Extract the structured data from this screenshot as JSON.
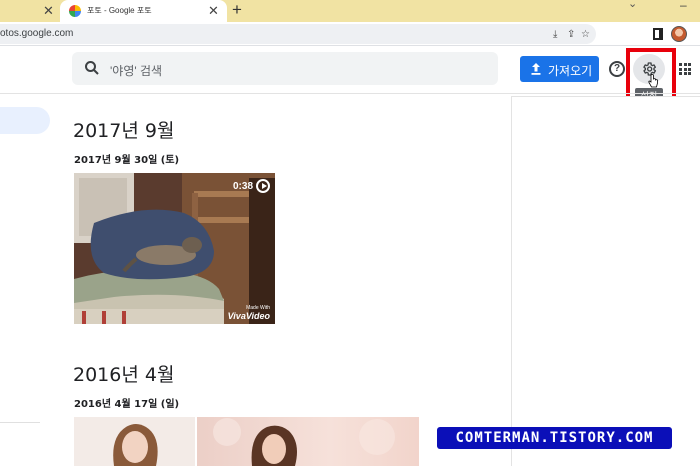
{
  "browser": {
    "tab_title": "포토 - Google 포토",
    "tab_close": "✕",
    "prev_tab_close": "✕",
    "new_tab": "+",
    "url": "otos.google.com"
  },
  "header": {
    "search_placeholder": "'야영' 검색",
    "import_label": "가져오기",
    "help_label": "?",
    "settings_tooltip": "설정"
  },
  "sections": [
    {
      "title": "2017년 9월",
      "date": "2017년 9월 30일 (토)",
      "video_duration": "0:38",
      "watermark_top": "Made With",
      "watermark_bottom": "VivaVideo"
    },
    {
      "title": "2016년 4월",
      "date": "2016년 4월 17일 (일)"
    }
  ],
  "banner": {
    "text": "COMTERMAN.TISTORY.COM"
  },
  "colors": {
    "accent": "#1a73e8",
    "highlight_box": "#e8000b",
    "tab_strip": "#f1e3a3",
    "banner": "#0b0fb8"
  }
}
